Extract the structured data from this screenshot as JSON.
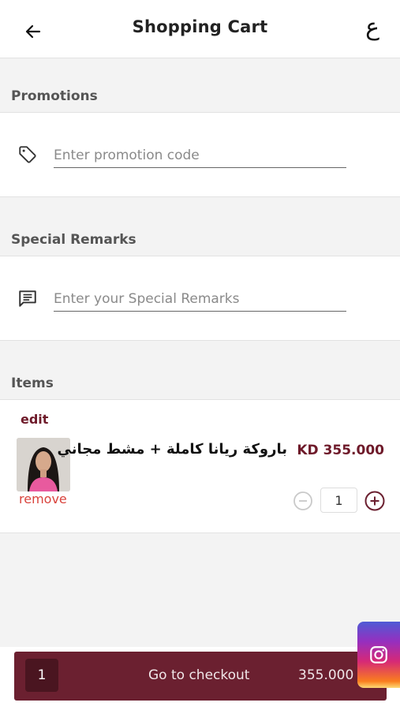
{
  "header": {
    "title": "Shopping Cart",
    "lang_toggle": "ع"
  },
  "promotions": {
    "label": "Promotions",
    "placeholder": "Enter promotion code",
    "value": ""
  },
  "remarks": {
    "label": "Special Remarks",
    "placeholder": "Enter your Special Remarks",
    "value": ""
  },
  "items": {
    "label": "Items",
    "list": [
      {
        "edit_label": "edit",
        "name": "باروكة ريانا كاملة + مشط مجاني",
        "price": "KD 355.000",
        "quantity": "1",
        "remove_label": "remove"
      }
    ]
  },
  "checkout": {
    "count": "1",
    "label": "Go to checkout",
    "total": "355.000"
  },
  "icons": {
    "back": "arrow-left-icon",
    "tag": "tag-icon",
    "remarks": "comment-icon",
    "minus": "minus-circle-icon",
    "plus": "plus-circle-icon",
    "instagram": "instagram-icon"
  },
  "colors": {
    "accent": "#6b2030",
    "accent_dark": "#4a1520",
    "remove": "#d9433c"
  }
}
